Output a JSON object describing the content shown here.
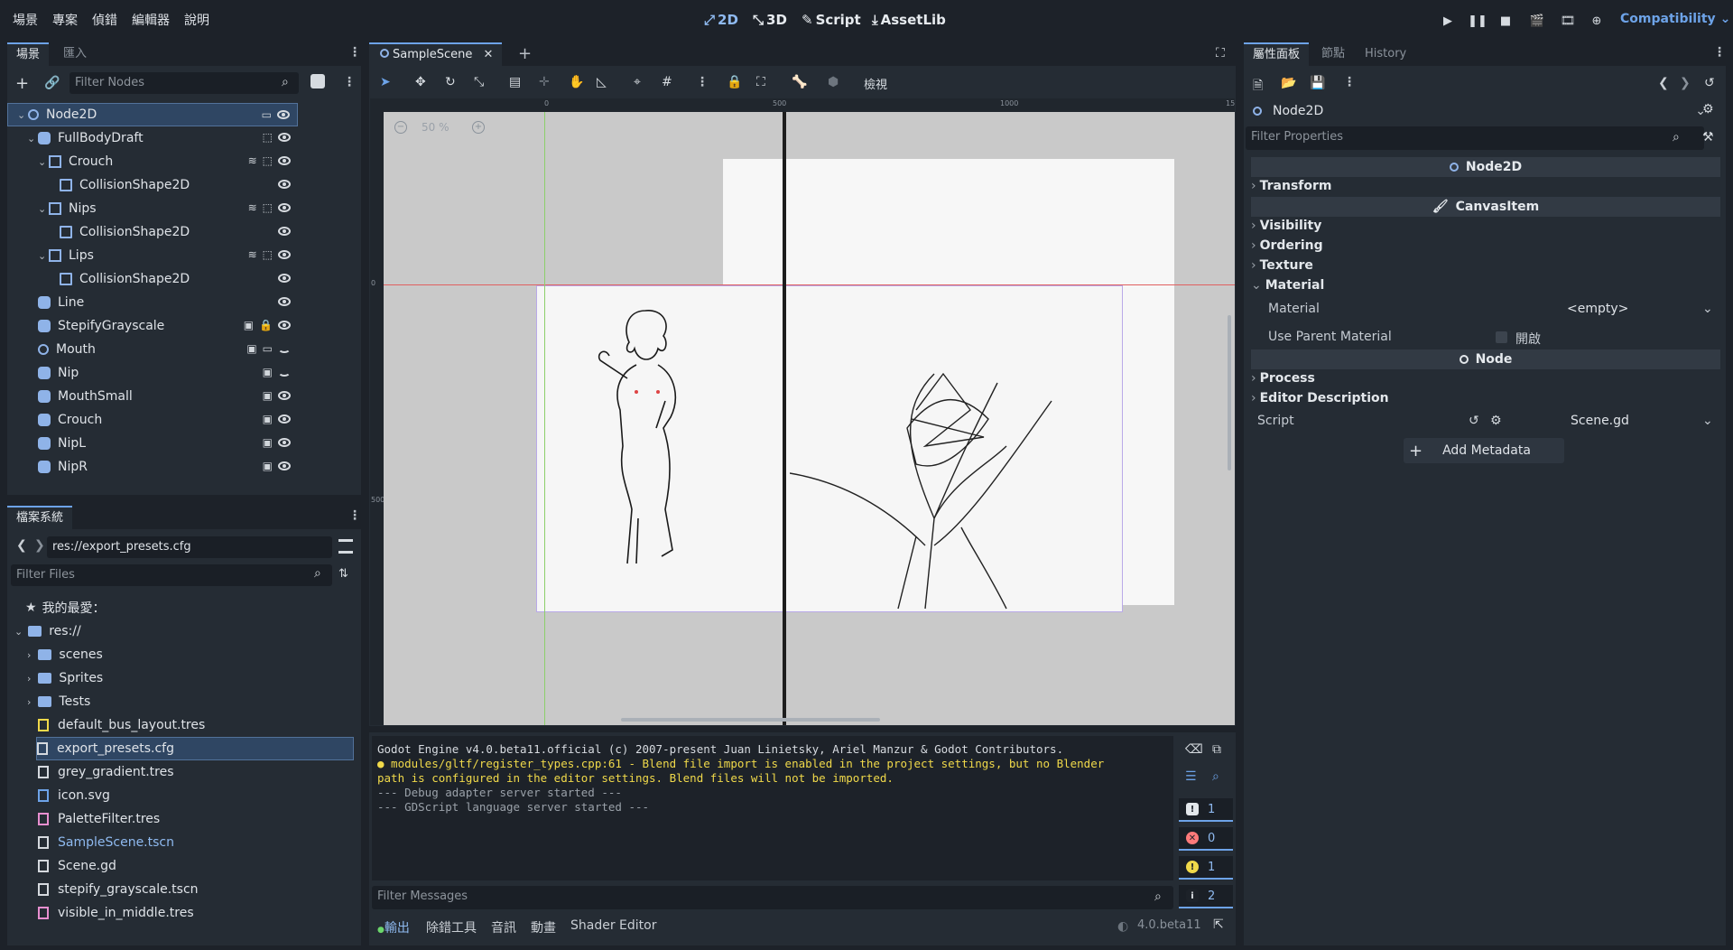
{
  "menubar": {
    "items": [
      "場景",
      "專案",
      "偵錯",
      "編輯器",
      "說明"
    ],
    "modes": [
      {
        "label": "2D",
        "icon": "2d-icon",
        "active": true
      },
      {
        "label": "3D",
        "icon": "3d-icon",
        "active": false
      },
      {
        "label": "Script",
        "icon": "script-icon",
        "active": false
      },
      {
        "label": "AssetLib",
        "icon": "assetlib-icon",
        "active": false
      }
    ],
    "renderer": "Compatibility"
  },
  "scene_dock": {
    "tabs": [
      "場景",
      "匯入"
    ],
    "filter_placeholder": "Filter Nodes",
    "nodes": [
      {
        "label": "Node2D",
        "depth": 0,
        "icon": "node2d-icon",
        "selected": true,
        "expanded": true
      },
      {
        "label": "FullBodyDraft",
        "depth": 1,
        "icon": "sprite-icon",
        "expanded": true
      },
      {
        "label": "Crouch",
        "depth": 2,
        "icon": "area2d-icon",
        "expanded": true
      },
      {
        "label": "CollisionShape2D",
        "depth": 3,
        "icon": "collision-icon"
      },
      {
        "label": "Nips",
        "depth": 2,
        "icon": "area2d-icon",
        "expanded": true
      },
      {
        "label": "CollisionShape2D",
        "depth": 3,
        "icon": "collision-icon"
      },
      {
        "label": "Lips",
        "depth": 2,
        "icon": "area2d-icon",
        "expanded": true
      },
      {
        "label": "CollisionShape2D",
        "depth": 3,
        "icon": "collision-icon"
      },
      {
        "label": "Line",
        "depth": 1,
        "icon": "sprite-icon"
      },
      {
        "label": "StepifyGrayscale",
        "depth": 1,
        "icon": "sprite-icon"
      },
      {
        "label": "Mouth",
        "depth": 1,
        "icon": "node2d-icon"
      },
      {
        "label": "Nip",
        "depth": 1,
        "icon": "sprite-icon"
      },
      {
        "label": "MouthSmall",
        "depth": 1,
        "icon": "sprite-icon"
      },
      {
        "label": "Crouch",
        "depth": 1,
        "icon": "sprite-icon"
      },
      {
        "label": "NipL",
        "depth": 1,
        "icon": "sprite-icon"
      },
      {
        "label": "NipR",
        "depth": 1,
        "icon": "sprite-icon"
      }
    ]
  },
  "filesystem": {
    "tab": "檔案系統",
    "path": "res://export_presets.cfg",
    "filter_placeholder": "Filter Files",
    "favorites_label": "我的最愛：",
    "root_label": "res://",
    "folders": [
      "scenes",
      "Sprites",
      "Tests"
    ],
    "files": [
      {
        "label": "default_bus_layout.tres",
        "icon": "audio-bus-icon"
      },
      {
        "label": "export_presets.cfg",
        "icon": "gear-icon",
        "selected": true
      },
      {
        "label": "grey_gradient.tres",
        "icon": "gradient-icon"
      },
      {
        "label": "icon.svg",
        "icon": "image-icon"
      },
      {
        "label": "PaletteFilter.tres",
        "icon": "resource-icon"
      },
      {
        "label": "SampleScene.tscn",
        "icon": "scene-icon",
        "highlight": true
      },
      {
        "label": "Scene.gd",
        "icon": "gear-icon"
      },
      {
        "label": "stepify_grayscale.tscn",
        "icon": "scene-icon"
      },
      {
        "label": "visible_in_middle.tres",
        "icon": "resource-icon"
      }
    ]
  },
  "viewport": {
    "scene_tab": "SampleScene",
    "view_menu": "檢視",
    "zoom": "50 %",
    "ruler_marks": [
      "0",
      "500",
      "1000",
      "15"
    ],
    "ruler_v_marks": [
      "0",
      "500"
    ]
  },
  "console": {
    "lines": [
      {
        "text": "Godot Engine v4.0.beta11.official (c) 2007-present Juan Linietsky, Ariel Manzur & Godot Contributors.",
        "color": "#d7dbe0"
      },
      {
        "text": "● modules/gltf/register_types.cpp:61 - Blend file import is enabled in the project settings, but no Blender",
        "color": "#f0d94a"
      },
      {
        "text": "path is configured in the editor settings. Blend files will not be imported.",
        "color": "#f0d94a"
      },
      {
        "text": "--- Debug adapter server started ---",
        "color": "#9aa1a9"
      },
      {
        "text": "--- GDScript language server started ---",
        "color": "#9aa1a9"
      }
    ],
    "filter_placeholder": "Filter Messages",
    "counts": {
      "messages": "1",
      "errors": "0",
      "warnings": "1",
      "info": "2"
    },
    "bottom_tabs": [
      "輸出",
      "除錯工具",
      "音訊",
      "動畫",
      "Shader Editor"
    ],
    "version": "4.0.beta11"
  },
  "inspector": {
    "tabs": [
      "屬性面板",
      "節點",
      "History"
    ],
    "node_name": "Node2D",
    "filter_placeholder": "Filter Properties",
    "sections": {
      "node2d": "Node2D",
      "transform": "Transform",
      "canvas_item": "CanvasItem",
      "visibility": "Visibility",
      "ordering": "Ordering",
      "texture": "Texture",
      "material": "Material",
      "material_prop": "Material",
      "material_value": "<empty>",
      "use_parent_material": "Use Parent Material",
      "use_parent_value": "開啟",
      "node": "Node",
      "process": "Process",
      "editor_description": "Editor Description",
      "script": "Script",
      "script_value": "Scene.gd",
      "add_metadata": "Add Metadata"
    }
  },
  "colors": {
    "accent": "#6da3e8",
    "bg": "#1d2229",
    "panel": "#252c34",
    "viewport_bg": "#c9c9c9"
  }
}
